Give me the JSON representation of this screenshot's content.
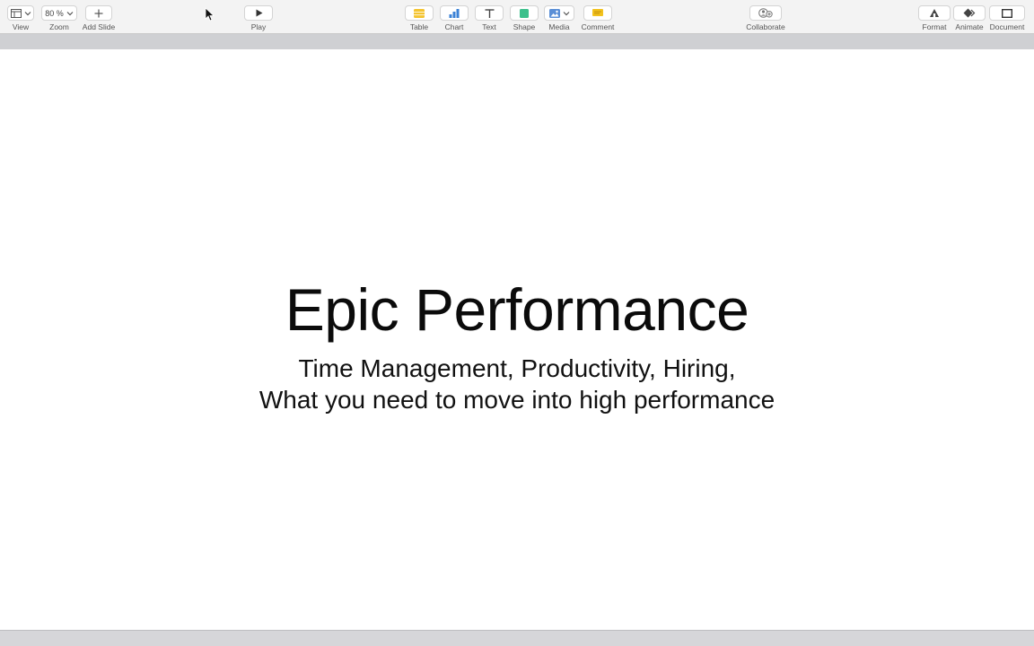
{
  "toolbar": {
    "view": {
      "label": "View"
    },
    "zoom": {
      "label": "Zoom",
      "value": "80 %"
    },
    "add_slide": {
      "label": "Add Slide"
    },
    "play": {
      "label": "Play"
    },
    "table": {
      "label": "Table"
    },
    "chart": {
      "label": "Chart"
    },
    "text": {
      "label": "Text"
    },
    "shape": {
      "label": "Shape"
    },
    "media": {
      "label": "Media"
    },
    "comment": {
      "label": "Comment"
    },
    "collaborate": {
      "label": "Collaborate"
    },
    "format": {
      "label": "Format"
    },
    "animate": {
      "label": "Animate"
    },
    "document": {
      "label": "Document"
    }
  },
  "slide": {
    "title": "Epic Performance",
    "subtitle_line1": "Time Management, Productivity, Hiring,",
    "subtitle_line2": "What you need to move into high performance"
  },
  "colors": {
    "table_icon": "#f4c430",
    "chart_icon": "#3b82d6",
    "shape_icon": "#3cc08c",
    "media_icon": "#5b8fd6",
    "comment_icon": "#f2c21d"
  }
}
